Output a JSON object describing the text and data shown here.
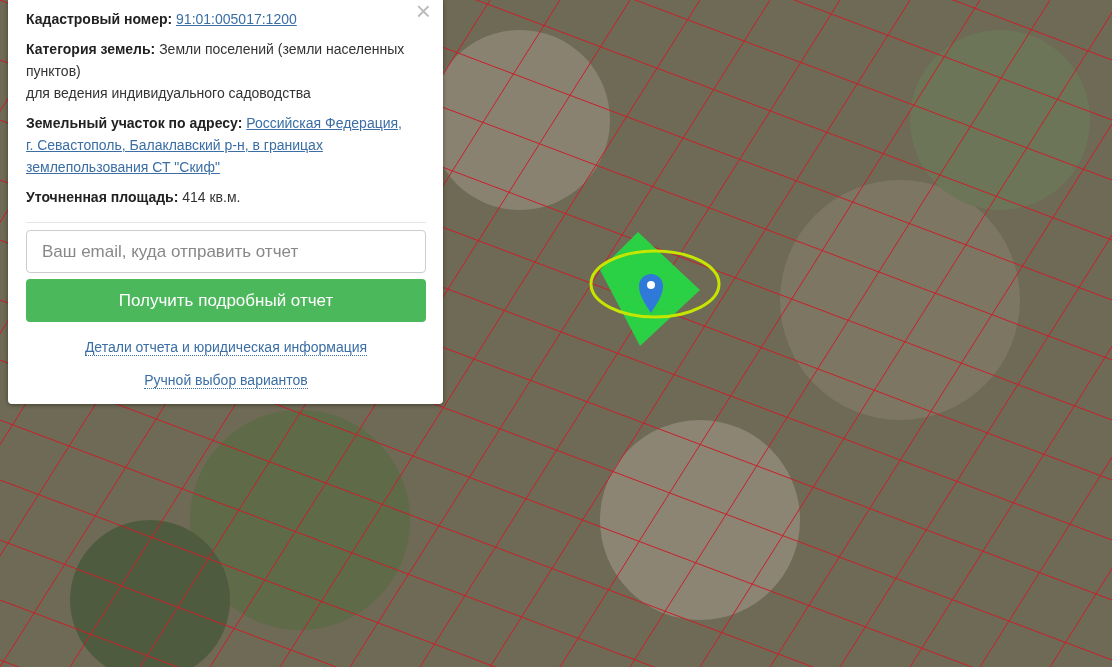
{
  "map": {
    "selected_parcel": true,
    "highlight_ring": true,
    "marker": true
  },
  "popup": {
    "fields": [
      {
        "label": "Кадастровый номер:",
        "kind": "link",
        "value": "91:01:005017:1200"
      },
      {
        "label": "Категория земель:",
        "kind": "text",
        "value": "Земли поселений (земли населенных пунктов)",
        "note": "для ведения индивидуального садоводства"
      },
      {
        "label": "Земельный участок по адресу:",
        "kind": "link",
        "value": "Российская Федерация,",
        "more_lines": [
          "г. Севастополь, Балаклавский р-н, в границах",
          "землепользования СТ \"Скиф\""
        ]
      },
      {
        "label": "Уточненная площадь:",
        "kind": "text",
        "value": "414 кв.м."
      }
    ],
    "close": "×",
    "email": {
      "placeholder": "Ваш email, куда отправить отчет"
    },
    "submit": "Получить подробный отчет",
    "links": [
      "Детали отчета и юридическая информация",
      "Ручной выбор вариантов"
    ]
  }
}
